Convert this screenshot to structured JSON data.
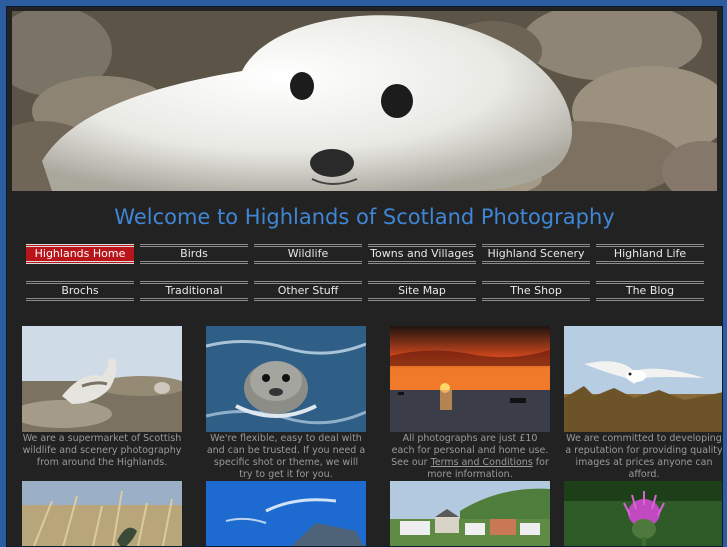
{
  "header": {
    "title": "Welcome to Highlands of Scotland Photography"
  },
  "banner": {
    "image": "seal-pup-photo"
  },
  "nav_row1": [
    {
      "label": "Highlands Home",
      "active": true
    },
    {
      "label": "Birds"
    },
    {
      "label": "Wildlife"
    },
    {
      "label": "Towns and Villages"
    },
    {
      "label": "Highland Scenery"
    },
    {
      "label": "Highland Life"
    }
  ],
  "nav_row2": [
    {
      "label": "Brochs"
    },
    {
      "label": "Traditional"
    },
    {
      "label": "Other Stuff"
    },
    {
      "label": "Site Map"
    },
    {
      "label": "The Shop"
    },
    {
      "label": "The Blog"
    }
  ],
  "cards": [
    {
      "image": "ptarmigan-photo",
      "caption": "We are a supermarket of Scottish wildlife and scenery photography from around the Highlands."
    },
    {
      "image": "swimming-seal-photo",
      "caption": "We're flexible, easy to deal with and can be trusted. If you need a specific shot or theme, we will try to get it for you."
    },
    {
      "image": "sunset-sea-photo",
      "caption_before": "All photographs are just £10 each for personal and home use. See our ",
      "caption_link": "Terms and Conditions",
      "caption_after": " for more information."
    },
    {
      "image": "fulmar-flight-photo",
      "caption": "We are committed to developing a reputation for providing quality images at prices anyone can afford."
    }
  ],
  "thumbs": [
    "dune-grass-photo",
    "blue-sky-mountain-photo",
    "village-houses-photo",
    "thistle-photo"
  ],
  "colors": {
    "page_bg": "#2b5d9e",
    "panel_bg": "#222222",
    "title": "#3f86d6",
    "active_nav": "#b8141a"
  }
}
